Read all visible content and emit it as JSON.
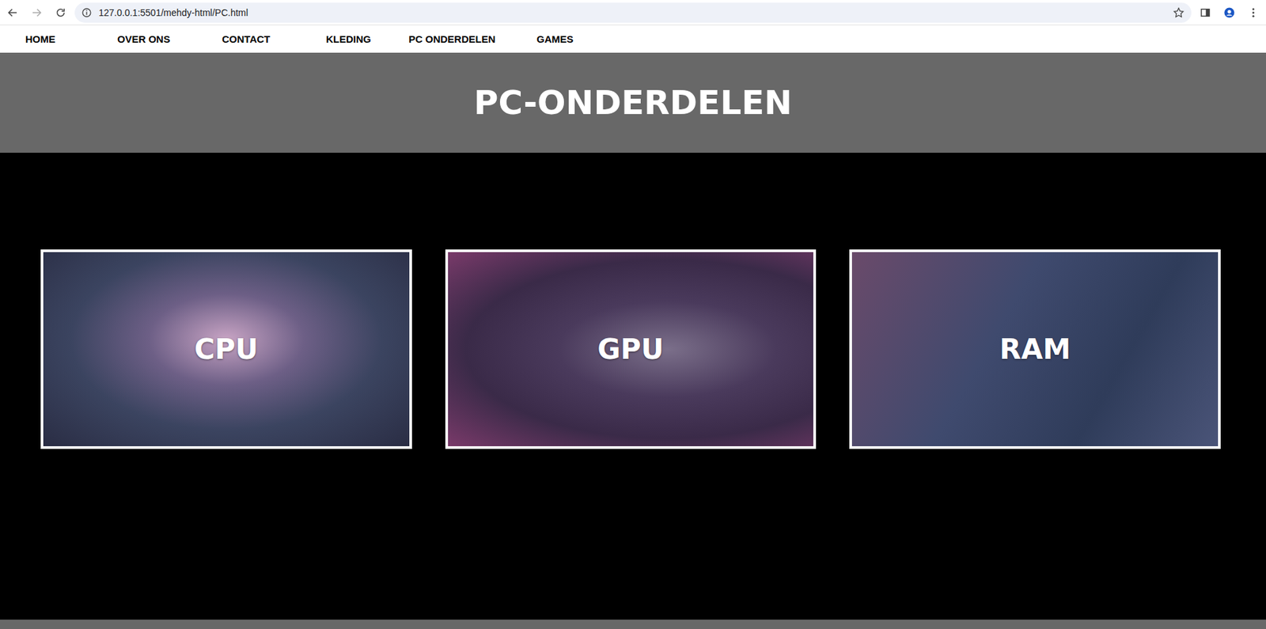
{
  "browser": {
    "url": "127.0.0.1:5501/mehdy-html/PC.html"
  },
  "nav": [
    "HOME",
    "OVER ONS",
    "CONTACT",
    "KLEDING",
    "PC ONDERDELEN",
    "GAMES"
  ],
  "header": {
    "title": "PC-ONDERDELEN"
  },
  "cards": [
    {
      "label": "CPU"
    },
    {
      "label": "GPU"
    },
    {
      "label": "RAM"
    }
  ]
}
